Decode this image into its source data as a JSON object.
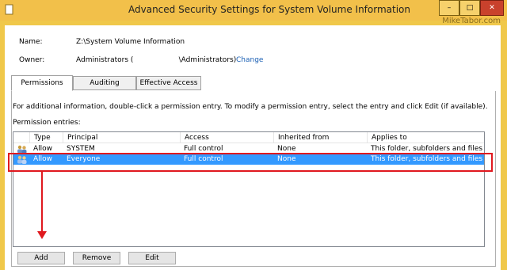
{
  "window": {
    "title": "Advanced Security Settings for System Volume Information",
    "watermark": "MikeTabor.com",
    "controls": {
      "minimize": "–",
      "maximize": "□",
      "close": "✕"
    }
  },
  "info": {
    "name_label": "Name:",
    "name_value": "Z:\\System Volume Information",
    "owner_label": "Owner:",
    "owner_value": "Administrators (                    \\Administrators)",
    "change_link": "Change"
  },
  "tabs": [
    {
      "label": "Permissions",
      "active": true
    },
    {
      "label": "Auditing",
      "active": false
    },
    {
      "label": "Effective Access",
      "active": false
    }
  ],
  "permissions": {
    "intro": "For additional information, double-click a permission entry. To modify a permission entry, select the entry and click Edit (if available).",
    "entries_label": "Permission entries:",
    "columns": [
      "Type",
      "Principal",
      "Access",
      "Inherited from",
      "Applies to"
    ],
    "rows": [
      {
        "icon": "user-group-icon",
        "type": "Allow",
        "principal": "SYSTEM",
        "access": "Full control",
        "inherited": "None",
        "applies": "This folder, subfolders and files",
        "selected": false
      },
      {
        "icon": "user-group-icon",
        "type": "Allow",
        "principal": "Everyone",
        "access": "Full control",
        "inherited": "None",
        "applies": "This folder, subfolders and files",
        "selected": true
      }
    ],
    "buttons": {
      "add": "Add",
      "remove": "Remove",
      "edit": "Edit"
    }
  },
  "colors": {
    "titlebar": "#f2c04a",
    "selection": "#3399ff",
    "annotation": "#e0191f",
    "link": "#1a5fb4"
  }
}
